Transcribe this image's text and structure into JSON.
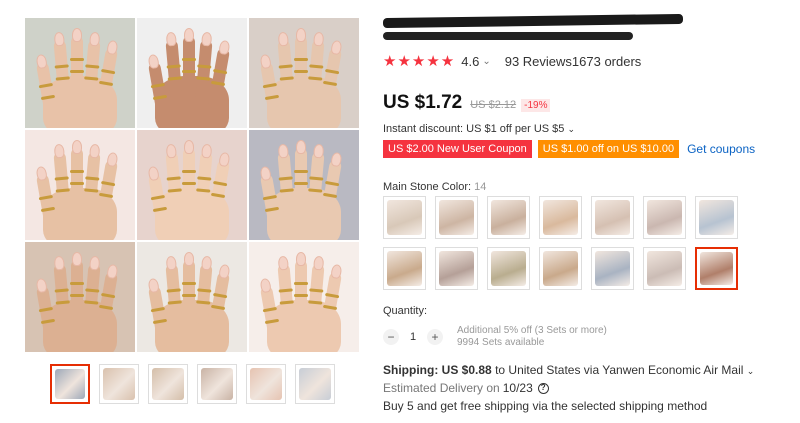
{
  "gallery": {
    "tiles": [
      {
        "bg": "#cfd2c9",
        "skin": "#e8c2a8"
      },
      {
        "bg": "#efefef",
        "skin": "#c58c6e"
      },
      {
        "bg": "#d9cfc8",
        "skin": "#e6c6ae"
      },
      {
        "bg": "#f4e7e3",
        "skin": "#e7c1a4"
      },
      {
        "bg": "#e7d3cd",
        "skin": "#f0cfb6"
      },
      {
        "bg": "#b9b9c2",
        "skin": "#e9c9b1"
      },
      {
        "bg": "#d7c3b3",
        "skin": "#dcb092"
      },
      {
        "bg": "#ece8e3",
        "skin": "#e5bd9f"
      },
      {
        "bg": "#f6eeea",
        "skin": "#edc9b0"
      }
    ],
    "thumbnails": [
      {
        "bg": "#9da8b8",
        "active": true
      },
      {
        "bg": "#d9c1ad"
      },
      {
        "bg": "#d4bea9"
      },
      {
        "bg": "#c9b3a5"
      },
      {
        "bg": "#e6c3b1"
      },
      {
        "bg": "#c7cdd6"
      }
    ]
  },
  "product": {
    "rating": {
      "stars": "★★★★★",
      "score": "4.6",
      "reviews": "93 Reviews",
      "orders": "1673 orders"
    },
    "price": {
      "current": "US $1.72",
      "original": "US $2.12",
      "discount": "-19%"
    },
    "instant_discount": "Instant discount: US $1 off per US $5",
    "coupons": [
      {
        "label": "US $2.00 New User Coupon",
        "style": "red"
      },
      {
        "label": "US $1.00 off on US $10.00",
        "style": "orange"
      }
    ],
    "get_coupons": "Get coupons",
    "main_stone": {
      "label": "Main Stone Color:",
      "count": "14",
      "swatches": [
        {
          "bg": "#d8c8b8"
        },
        {
          "bg": "#cdb5a3"
        },
        {
          "bg": "#c9b09d"
        },
        {
          "bg": "#d9b99d"
        },
        {
          "bg": "#d5c0b2"
        },
        {
          "bg": "#cab7b0"
        },
        {
          "bg": "#b7c3d1"
        },
        {
          "bg": "#c9aa8c"
        },
        {
          "bg": "#b5a098"
        },
        {
          "bg": "#b9ad8f"
        },
        {
          "bg": "#c9a98b"
        },
        {
          "bg": "#a9b3c2"
        },
        {
          "bg": "#cbbcb5"
        },
        {
          "bg": "#b07f6a",
          "selected": true
        }
      ]
    },
    "quantity": {
      "label": "Quantity:",
      "minus": "−",
      "plus": "+",
      "value": "1",
      "additional": "Additional 5% off (3 Sets or more)",
      "available": "9994 Sets available"
    },
    "shipping": {
      "label": "Shipping:",
      "price": "US $0.88",
      "text": "to United States via Yanwen Economic Air Mail",
      "estimated_label": "Estimated Delivery on",
      "estimated_date": "10/23",
      "help": "?",
      "free_shipping": "Buy 5 and get free shipping via the selected shipping method"
    }
  }
}
